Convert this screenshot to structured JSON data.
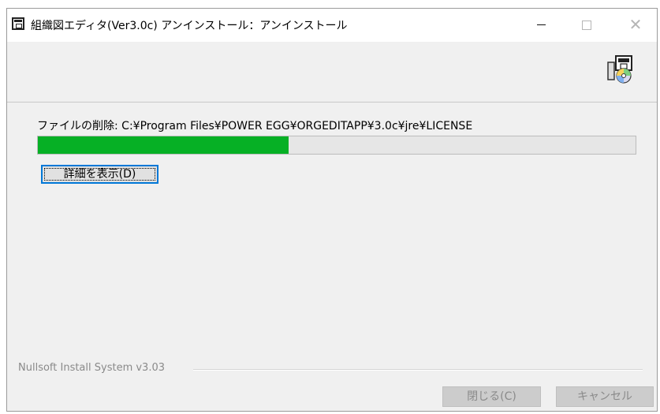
{
  "window": {
    "title": "組織図エディタ(Ver3.0c) アンインストール：アンインストール",
    "controls": {
      "minimize": "—",
      "maximize": "",
      "close": "✕"
    }
  },
  "header": {
    "icon": "installer-disk-icon"
  },
  "main": {
    "status_text": "ファイルの削除: C:¥Program Files¥POWER EGG¥ORGEDITAPP¥3.0c¥jre¥LICENSE",
    "progress_percent": 42,
    "details_button": "詳細を表示(D)"
  },
  "footer": {
    "branding": "Nullsoft Install System v3.03",
    "close_button": "閉じる(C)",
    "cancel_button": "キャンセル"
  },
  "colors": {
    "progress_fill": "#06b025",
    "focus_border": "#0078d7",
    "disabled_text": "#8a8a8a"
  }
}
